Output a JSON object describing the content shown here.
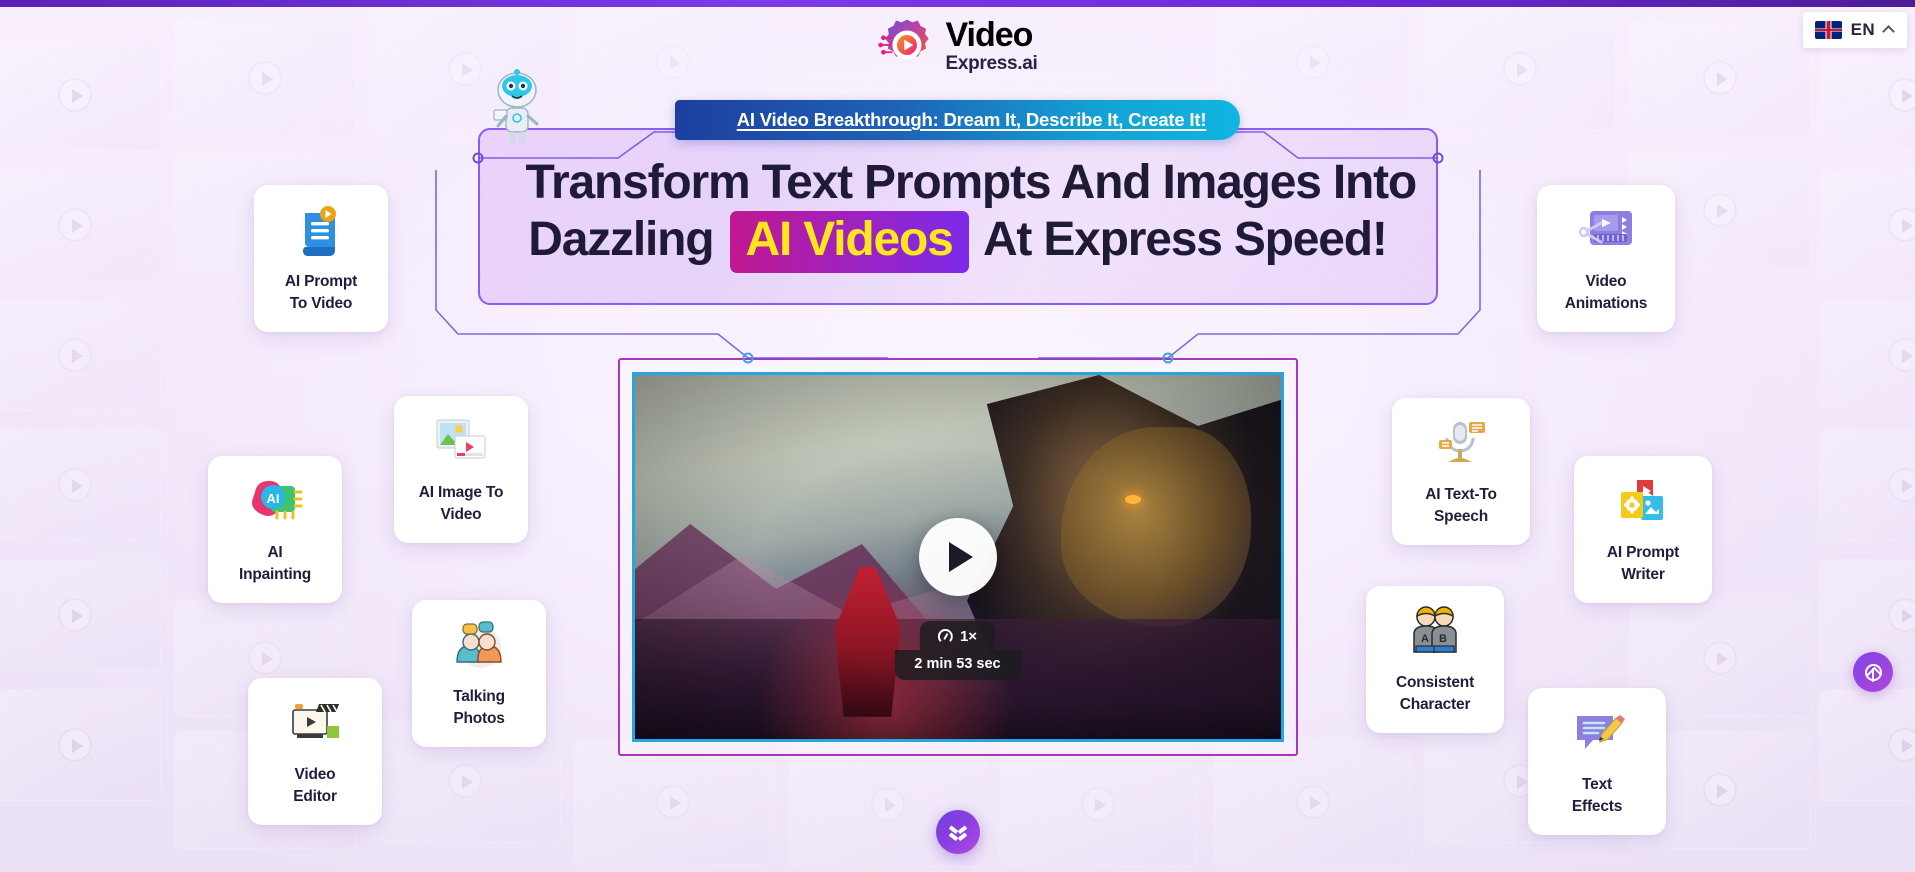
{
  "brand": {
    "name_top": "Video",
    "name_bottom": "Express.ai",
    "logo_icon": "gear-play-logo-icon",
    "accent_purple": "#7c3aed",
    "accent_magenta": "#c0188f",
    "accent_cyan": "#22a7e0",
    "highlight_yellow": "#ffe71f"
  },
  "language_selector": {
    "flag_icon": "uk-flag-icon",
    "code": "EN",
    "chevron_icon": "chevron-up-icon"
  },
  "hero": {
    "ribbon": "AI Video Breakthrough: Dream It, Describe It, Create It!",
    "robot_icon": "robot-mascot-icon",
    "headline_line1": "Transform Text Prompts And Images Into",
    "headline_line2_pre": "Dazzling",
    "headline_badge": "AI Videos",
    "headline_line2_post": "At Express Speed!"
  },
  "video": {
    "play_icon": "play-button-icon",
    "speed_icon": "gauge-icon",
    "speed_label": "1×",
    "duration_label": "2 min 53 sec"
  },
  "cards_left": [
    {
      "id": "ai-prompt-to-video",
      "icon": "document-play-icon",
      "line1": "AI Prompt",
      "line2": "To Video"
    },
    {
      "id": "ai-image-to-video",
      "icon": "image-video-icon",
      "line1": "AI Image To",
      "line2": "Video"
    },
    {
      "id": "ai-inpainting",
      "icon": "ai-chip-icon",
      "line1": "AI",
      "line2": "Inpainting"
    },
    {
      "id": "talking-photos",
      "icon": "talking-heads-icon",
      "line1": "Talking",
      "line2": "Photos"
    },
    {
      "id": "video-editor",
      "icon": "monitor-clapper-icon",
      "line1": "Video",
      "line2": "Editor"
    }
  ],
  "cards_right": [
    {
      "id": "video-animations",
      "icon": "video-timeline-icon",
      "line1": "Video",
      "line2": "Animations"
    },
    {
      "id": "ai-text-to-speech",
      "icon": "microphone-icon",
      "line1": "AI Text-To",
      "line2": "Speech"
    },
    {
      "id": "ai-prompt-writer",
      "icon": "files-stack-icon",
      "line1": "AI Prompt",
      "line2": "Writer"
    },
    {
      "id": "consistent-character",
      "icon": "two-people-ab-icon",
      "line1": "Consistent",
      "line2": "Character"
    },
    {
      "id": "text-effects",
      "icon": "speech-pencil-icon",
      "line1": "Text",
      "line2": "Effects"
    }
  ],
  "widgets": {
    "scroll_down_icon": "double-chevron-down-icon",
    "floating_action_icon": "upload-circle-icon"
  }
}
